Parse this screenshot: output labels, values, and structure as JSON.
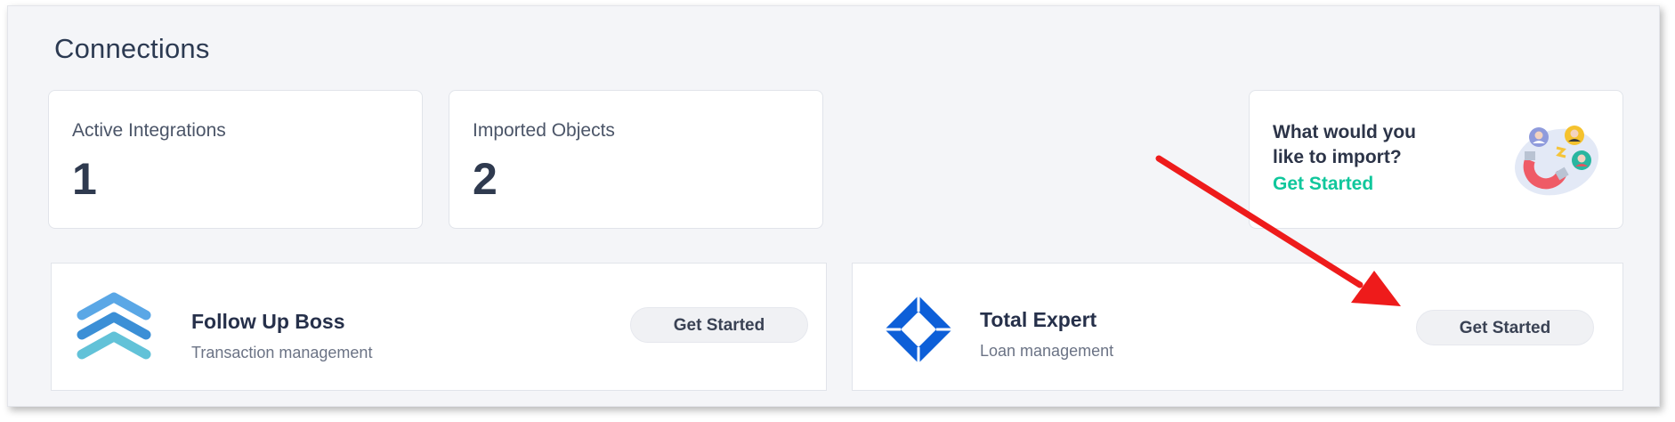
{
  "page": {
    "title": "Connections"
  },
  "stats": [
    {
      "label": "Active Integrations",
      "value": "1"
    },
    {
      "label": "Imported Objects",
      "value": "2"
    }
  ],
  "import_prompt": {
    "title": "What would you like to import?",
    "link_label": "Get Started",
    "link_color": "#10c79c",
    "art_icon": "magnet-people-icon"
  },
  "integrations": [
    {
      "name": "Follow Up Boss",
      "subtitle": "Transaction management",
      "button_label": "Get Started",
      "logo_icon": "chevrons-up-icon",
      "logo_color": "#3b8fd6"
    },
    {
      "name": "Total Expert",
      "subtitle": "Loan management",
      "button_label": "Get Started",
      "logo_icon": "diamond-logo-icon",
      "logo_color": "#0d5fd8"
    }
  ],
  "annotation": {
    "arrow_color": "#ee1b1b"
  }
}
